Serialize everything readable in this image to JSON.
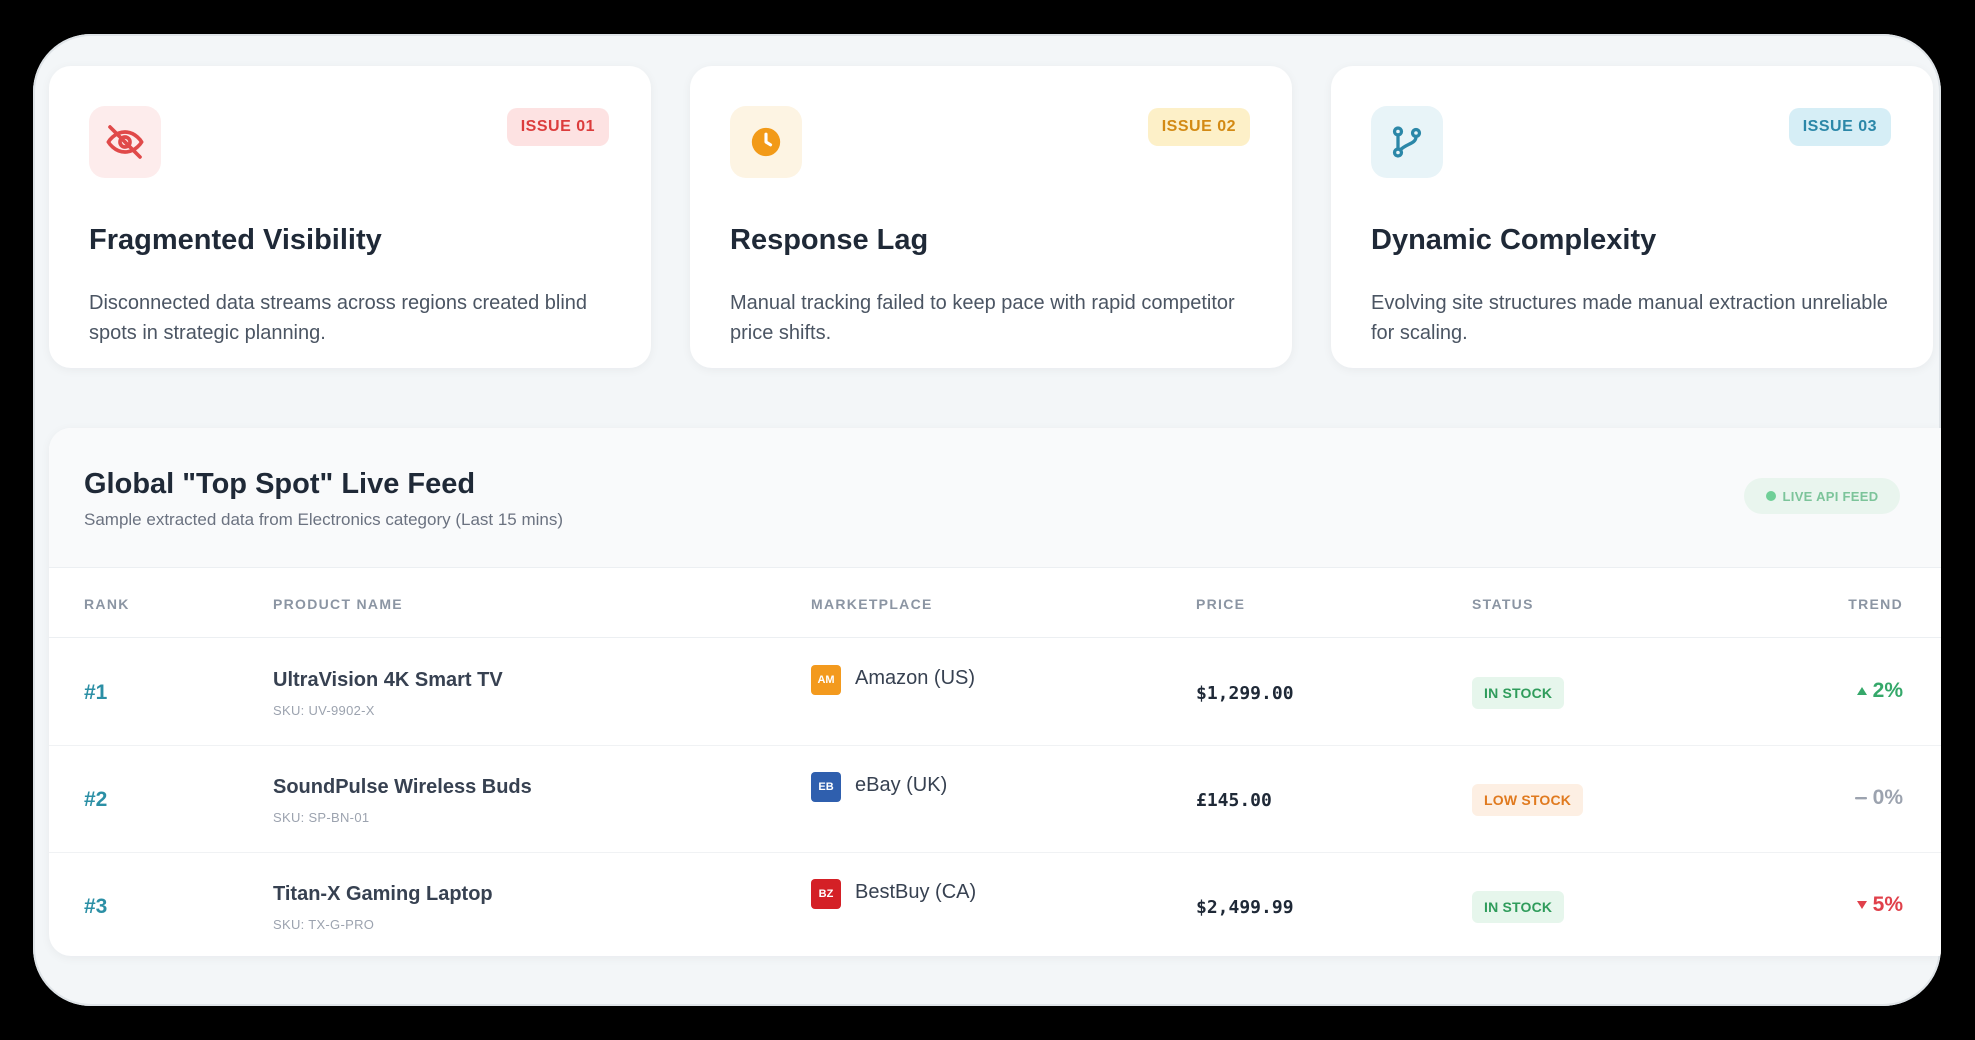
{
  "issues": [
    {
      "badge": "ISSUE 01",
      "icon": "eye-off-icon",
      "title": "Fragmented Visibility",
      "description": "Disconnected data streams across regions created blind spots in strategic planning."
    },
    {
      "badge": "ISSUE 02",
      "icon": "clock-icon",
      "title": "Response Lag",
      "description": "Manual tracking failed to keep pace with rapid competitor price shifts."
    },
    {
      "badge": "ISSUE 03",
      "icon": "git-branch-icon",
      "title": "Dynamic Complexity",
      "description": "Evolving site structures made manual extraction unreliable for scaling."
    }
  ],
  "feed": {
    "title": "Global \"Top Spot\" Live Feed",
    "subtitle": "Sample extracted data from Electronics category (Last 15 mins)",
    "live_label": "LIVE API FEED",
    "columns": [
      "RANK",
      "PRODUCT NAME",
      "MARKETPLACE",
      "PRICE",
      "STATUS",
      "TREND"
    ],
    "rows": [
      {
        "rank": "#1",
        "product": "UltraVision 4K Smart TV",
        "sku": "SKU: UV-9902-X",
        "marketplace_code": "AM",
        "marketplace": "Amazon (US)",
        "marketplace_color": "#f39a1e",
        "price": "$1,299.00",
        "status": "IN STOCK",
        "trend": "2%",
        "trend_dir": "up"
      },
      {
        "rank": "#2",
        "product": "SoundPulse Wireless Buds",
        "sku": "SKU: SP-BN-01",
        "marketplace_code": "EB",
        "marketplace": "eBay (UK)",
        "marketplace_color": "#2f5fae",
        "price": "£145.00",
        "status": "LOW STOCK",
        "trend": "0%",
        "trend_dir": "flat"
      },
      {
        "rank": "#3",
        "product": "Titan-X Gaming Laptop",
        "sku": "SKU: TX-G-PRO",
        "marketplace_code": "BZ",
        "marketplace": "BestBuy (CA)",
        "marketplace_color": "#d42026",
        "price": "$2,499.99",
        "status": "IN STOCK",
        "trend": "5%",
        "trend_dir": "down"
      }
    ]
  },
  "colors": {
    "accent_teal": "#2b8fa5",
    "issue_red": "#dc3c3c",
    "issue_amber": "#d38a14",
    "issue_blue": "#2b87a8",
    "trend_up": "#35a86a",
    "trend_down": "#e0414b"
  }
}
